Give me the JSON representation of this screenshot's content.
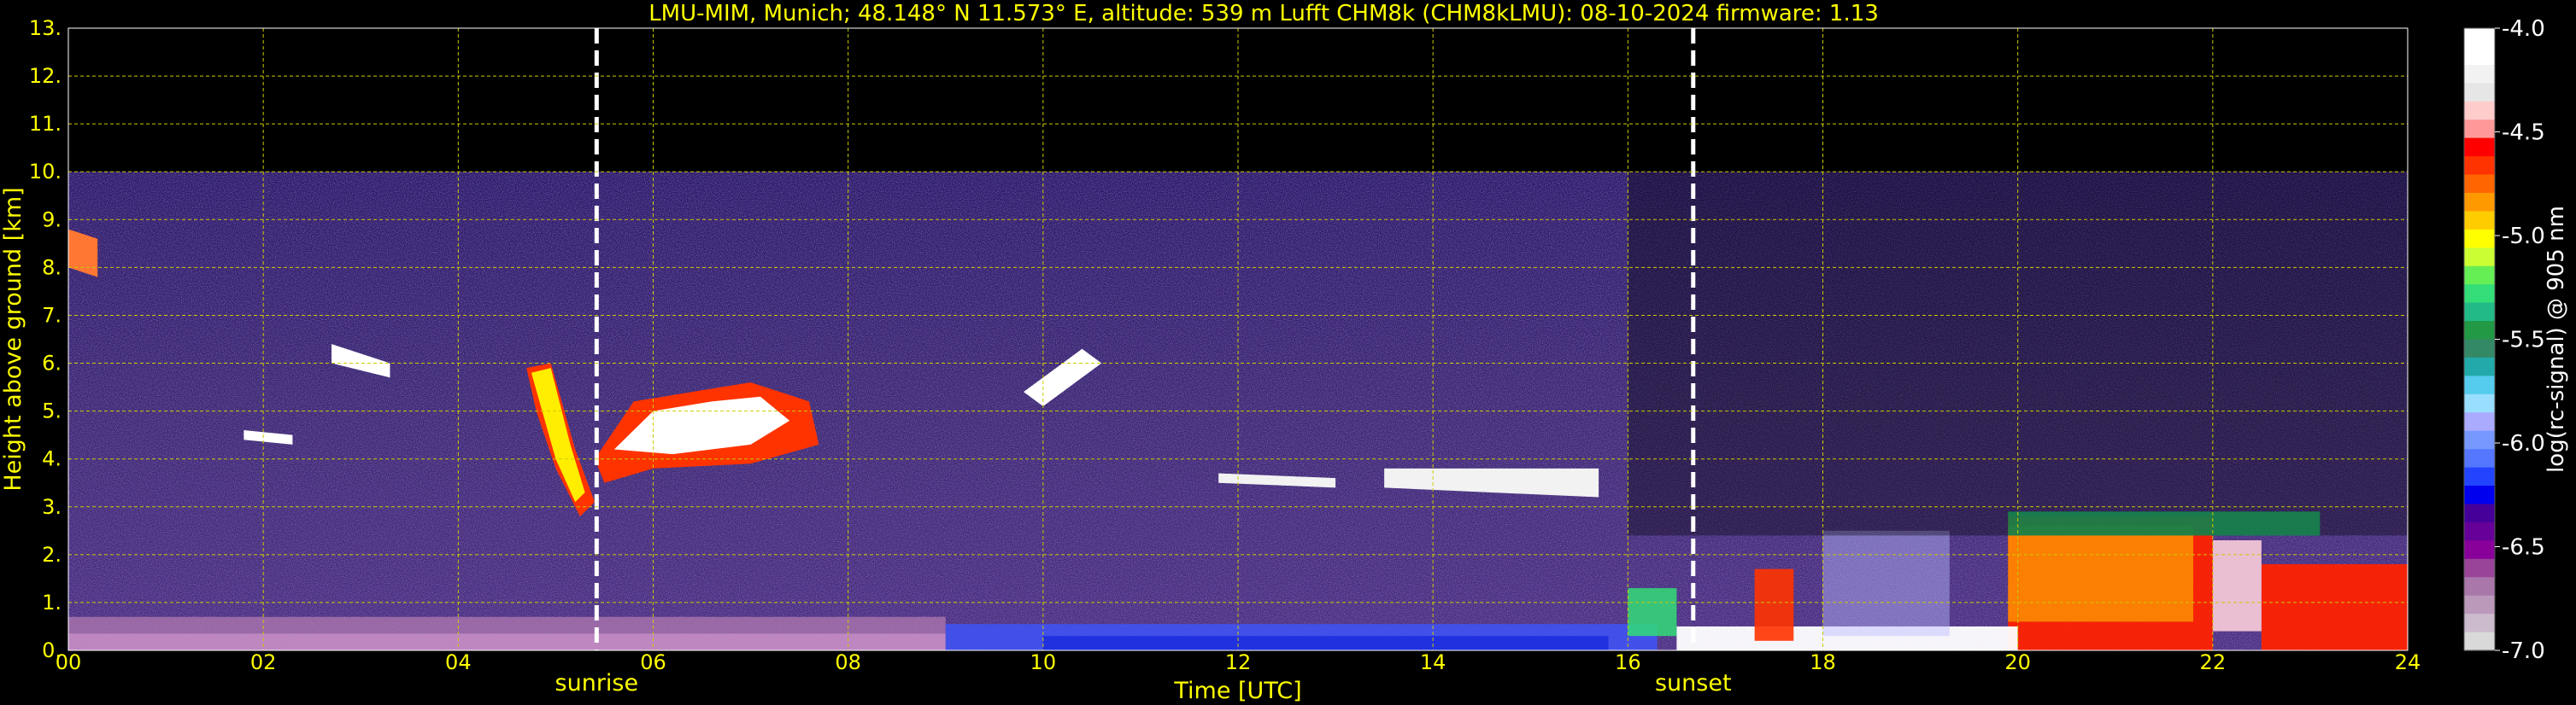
{
  "chart_data": {
    "type": "heatmap",
    "title": "LMU-MIM, Munich; 48.148° N 11.573° E, altitude: 539 m    Lufft CHM8k (CHM8kLMU): 08-10-2024    firmware: 1.13",
    "xlabel": "Time [UTC]",
    "ylabel": "Height above ground [km]",
    "xlim": [
      0,
      24
    ],
    "ylim": [
      0,
      13
    ],
    "x_tick_labels": [
      "00",
      "02",
      "04",
      "06",
      "08",
      "10",
      "12",
      "14",
      "16",
      "18",
      "20",
      "22",
      "24"
    ],
    "y_tick_labels": [
      "0.",
      "1.",
      "2.",
      "3.",
      "4.",
      "5.",
      "6.",
      "7.",
      "8.",
      "9.",
      "10.",
      "11.",
      "12.",
      "13."
    ],
    "grid": true,
    "markers": [
      {
        "label": "sunrise",
        "x": 5.42
      },
      {
        "label": "sunset",
        "x": 16.67
      }
    ],
    "colorbar": {
      "label": "log(rc-signal) @ 905 nm",
      "range": [
        -7.0,
        -4.0
      ],
      "tick_labels": [
        "-4.0",
        "-4.5",
        "-5.0",
        "-5.5",
        "-6.0",
        "-6.5",
        "-7.0"
      ],
      "colors": [
        "#ffffff",
        "#ffffff",
        "#f2f2f2",
        "#e6e6e6",
        "#ffcccc",
        "#ff9999",
        "#ff0000",
        "#ff3300",
        "#ff6600",
        "#ff9900",
        "#ffcc00",
        "#ffff00",
        "#ccff33",
        "#66ee55",
        "#33dd77",
        "#22bb88",
        "#229944",
        "#338866",
        "#22aaaa",
        "#55ccee",
        "#99ddff",
        "#aaaaff",
        "#7799ff",
        "#5577ff",
        "#2244ff",
        "#0000ee",
        "#440099",
        "#660099",
        "#880099",
        "#994499",
        "#aa77aa",
        "#bb99bb",
        "#ccbbcc",
        "#d9d9d9"
      ]
    },
    "data_top_km": 10.0,
    "features": [
      {
        "name": "surface aerosol layer",
        "x": [
          0,
          24
        ],
        "height_km": [
          0,
          0.9
        ]
      },
      {
        "name": "mid-level cloud",
        "x": [
          4.5,
          7.8
        ],
        "height_km": [
          3.0,
          6.0
        ]
      },
      {
        "name": "sparse cloud fragments",
        "x": [
          8,
          15.8
        ],
        "height_km": [
          3.2,
          6.5
        ]
      },
      {
        "name": "boundary layer clouds",
        "x": [
          16.5,
          24
        ],
        "height_km": [
          0,
          3.0
        ]
      }
    ],
    "colors": {
      "background": "#000000",
      "axes_text": "#ffff00",
      "grid": "#cccc00",
      "markers": "#ffffff"
    }
  }
}
